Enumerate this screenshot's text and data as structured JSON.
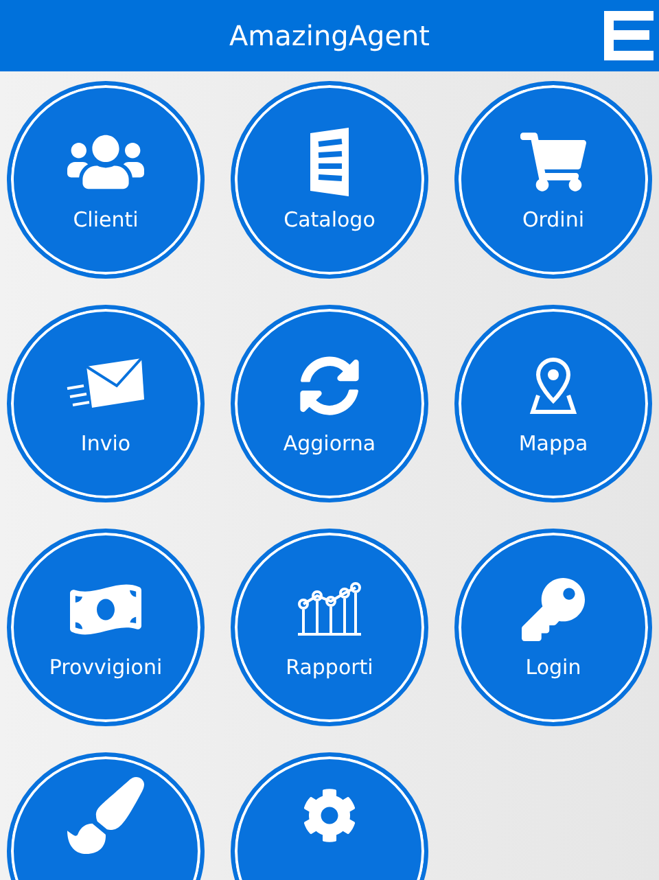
{
  "header": {
    "title": "AmazingAgent"
  },
  "tiles": [
    {
      "label": "Clienti"
    },
    {
      "label": "Catalogo"
    },
    {
      "label": "Ordini"
    },
    {
      "label": "Invio"
    },
    {
      "label": "Aggiorna"
    },
    {
      "label": "Mappa"
    },
    {
      "label": "Provvigioni"
    },
    {
      "label": "Rapporti"
    },
    {
      "label": "Login"
    }
  ]
}
